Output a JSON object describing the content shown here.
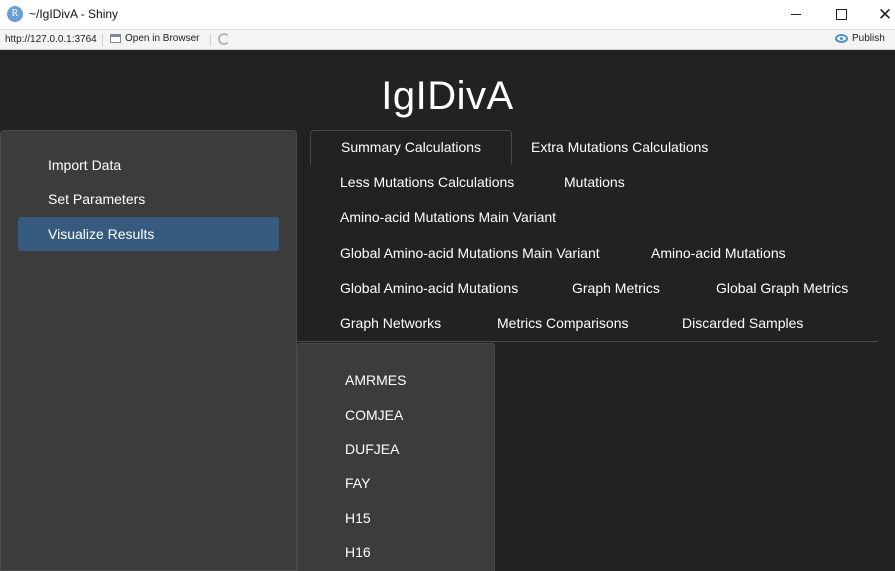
{
  "window": {
    "app_icon_letter": "R",
    "title": "~/IgIDivA - Shiny",
    "minimize_icon": "minimize-icon",
    "maximize_icon": "maximize-icon",
    "close_glyph": "✕"
  },
  "addressbar": {
    "url": "http://127.0.0.1:3764",
    "open_browser_label": "Open in Browser",
    "publish_label": "Publish"
  },
  "app": {
    "title": "IgIDivA",
    "sidebar": {
      "items": [
        {
          "label": "Import Data",
          "active": false
        },
        {
          "label": "Set Parameters",
          "active": false
        },
        {
          "label": "Visualize Results",
          "active": true
        }
      ]
    },
    "tabs": [
      {
        "label": "Summary Calculations",
        "active": true
      },
      {
        "label": "Extra Mutations Calculations",
        "active": false
      },
      {
        "label": "Less Mutations Calculations",
        "active": false
      },
      {
        "label": "Mutations",
        "active": false
      },
      {
        "label": "Amino-acid Mutations Main Variant",
        "active": false
      },
      {
        "label": "Global Amino-acid Mutations Main Variant",
        "active": false
      },
      {
        "label": "Amino-acid Mutations",
        "active": false
      },
      {
        "label": "Global Amino-acid Mutations",
        "active": false
      },
      {
        "label": "Graph Metrics",
        "active": false
      },
      {
        "label": "Global Graph Metrics",
        "active": false
      },
      {
        "label": "Graph Networks",
        "active": false
      },
      {
        "label": "Metrics Comparisons",
        "active": false
      },
      {
        "label": "Discarded Samples",
        "active": false
      }
    ],
    "sample_list": [
      "AMRMES",
      "COMJEA",
      "DUFJEA",
      "FAY",
      "H15",
      "H16"
    ]
  },
  "colors": {
    "background": "#222222",
    "panel": "#3c3c3c",
    "active_nav": "#375a7f",
    "text": "#ffffff"
  }
}
